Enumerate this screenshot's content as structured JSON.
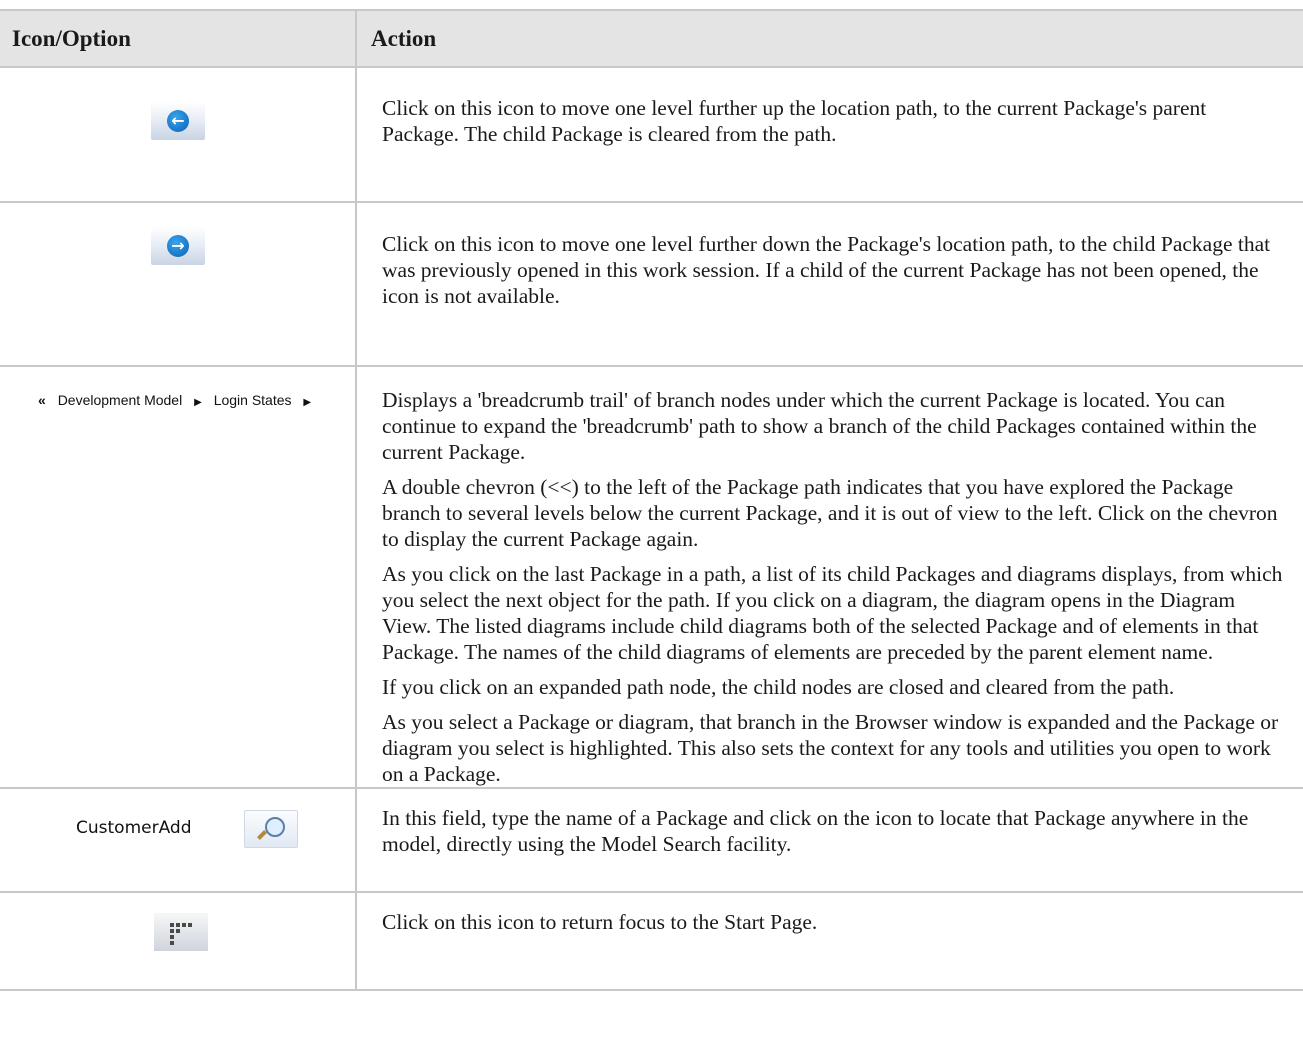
{
  "header": {
    "col1": "Icon/Option",
    "col2": "Action"
  },
  "rows": [
    {
      "icon": "back-arrow-icon",
      "text": "Click on this icon to move one level further up the location path, to the current Package's parent Package. The child Package is cleared from the path."
    },
    {
      "icon": "forward-arrow-icon",
      "text": "Click on this icon to move one level further down the Package's location path, to the child Package that was previously opened in this work session. If a child of the current Package has not been opened, the icon is not available."
    },
    {
      "breadcrumb": {
        "chevron": "«",
        "items": [
          "Development Model",
          "Login States"
        ]
      },
      "paragraphs": [
        "Displays a 'breadcrumb trail' of branch nodes under which the current Package is located. You can continue to expand the 'breadcrumb' path to show a branch of the child Packages contained within the current Package.",
        "A double chevron (<<) to the left of the Package path indicates that you have explored the Package branch to several levels below the current Package, and it is out of view to the left. Click on the chevron to display the current Package again.",
        "As you click on the last Package in a path, a list of its child Packages and diagrams displays, from which you select the next object for the path. If you click on a diagram, the diagram opens in the Diagram View. The listed diagrams include child diagrams both of the selected Package and of elements in that Package. The names of the child diagrams of elements are preceded by the parent element name.",
        "If you click on an expanded path node, the child nodes are closed and cleared from the path.",
        "As you select a Package or diagram, that branch in the Browser window is expanded and the Package or diagram you select is highlighted. This also sets the context for any tools and utilities you open to work on a Package."
      ]
    },
    {
      "search_value": "CustomerAdd",
      "icon": "search-icon",
      "text": "In this field, type the name of a Package and click on the icon to locate that Package anywhere in the model, directly using the Model Search facility."
    },
    {
      "icon": "start-page-icon",
      "text": "Click on this icon to return focus to the Start Page."
    }
  ]
}
